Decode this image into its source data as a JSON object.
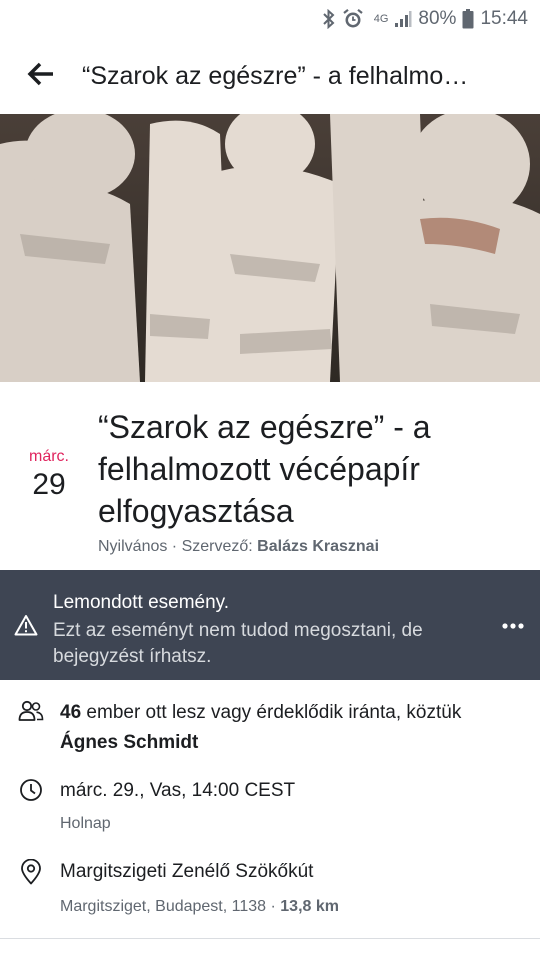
{
  "status_bar": {
    "network": "4G",
    "battery": "80%",
    "time": "15:44",
    "icons": [
      "bluetooth-icon",
      "alarm-icon",
      "network-4g-icon",
      "signal-icon",
      "battery-icon"
    ]
  },
  "header": {
    "title": "“Szarok az egészre” - a felhalmo…",
    "back_icon": "arrow-left-icon"
  },
  "event": {
    "date_month": "márc.",
    "date_day": "29",
    "title": "“Szarok az egészre” - a felhalmozott vécépapír elfogyasztása",
    "visibility": "Nyilvános",
    "separator": " · ",
    "organizer_label": "Szervező: ",
    "organizer": "Balázs Krasznai"
  },
  "cancel_banner": {
    "title": "Lemondott esemény.",
    "text": "Ezt az eseményt nem tudod megosztani, de bejegyzést írhatsz.",
    "icon": "warning-icon",
    "more_icon": "more-icon"
  },
  "details": {
    "attendees": {
      "count": "46",
      "text": " ember ott lesz vagy érdeklődik iránta, köztük",
      "name": "Ágnes Schmidt",
      "icon": "people-icon"
    },
    "time": {
      "main": "márc. 29., Vas, 14:00 CEST",
      "sub": "Holnap",
      "icon": "clock-icon"
    },
    "location": {
      "name": "Margitszigeti Zenélő Szökőkút",
      "address": "Margitsziget, Budapest, 1138",
      "separator": " · ",
      "distance": "13,8 km",
      "icon": "location-pin-icon"
    }
  },
  "colors": {
    "month_red": "#e0245e",
    "banner_bg": "#3e4553",
    "muted_text": "#606770"
  }
}
